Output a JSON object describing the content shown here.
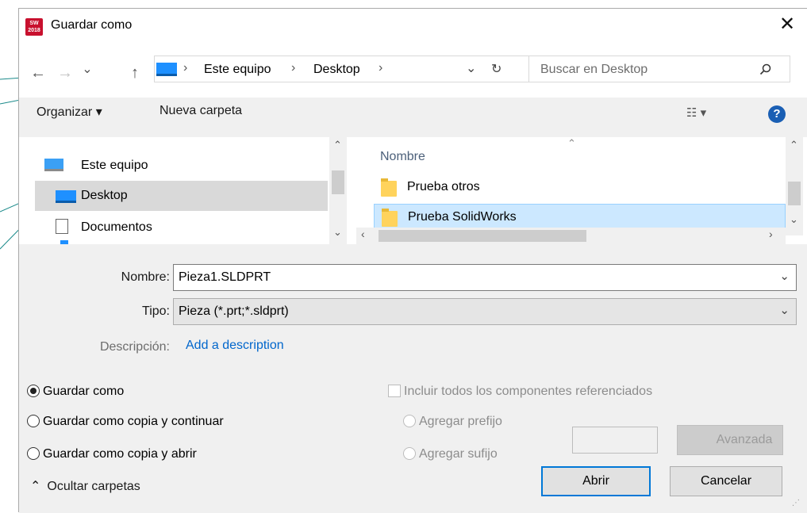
{
  "window": {
    "title": "Guardar como",
    "app_icon_text": "SW 2018"
  },
  "nav": {
    "back_arrow": "←",
    "forward_arrow": "→",
    "recent_chevron": "⌄",
    "up_arrow": "↑",
    "breadcrumb": [
      "Este equipo",
      "Desktop"
    ],
    "separator": "›",
    "refresh": "↻",
    "search_placeholder": "Buscar en Desktop"
  },
  "toolbar": {
    "organize": "Organizar ▾",
    "new_folder": "Nueva carpeta",
    "view_icon": "view-options-icon",
    "help": "?"
  },
  "nav_pane": {
    "items": [
      {
        "label": "Este equipo",
        "icon": "computer-icon"
      },
      {
        "label": "Desktop",
        "icon": "desktop-icon",
        "selected": true
      },
      {
        "label": "Documentos",
        "icon": "documents-icon"
      }
    ]
  },
  "file_pane": {
    "column_header": "Nombre",
    "rows": [
      {
        "label": "Prueba otros",
        "icon": "folder-icon"
      },
      {
        "label": "Prueba SolidWorks",
        "icon": "folder-icon",
        "selected": true
      }
    ]
  },
  "form": {
    "name_label": "Nombre:",
    "name_value": "Pieza1.SLDPRT",
    "type_label": "Tipo:",
    "type_value": "Pieza (*.prt;*.sldprt)",
    "desc_label": "Descripción:",
    "desc_link": "Add a description"
  },
  "options": {
    "radio_save": "Guardar como",
    "radio_copy_continue": "Guardar como copia y continuar",
    "radio_copy_open": "Guardar como copia y abrir",
    "include_refs": "Incluir todos los componentes referenciados",
    "add_prefix": "Agregar prefijo",
    "add_suffix": "Agregar sufijo",
    "advanced": "Avanzada"
  },
  "footer": {
    "hide_folders": "Ocultar carpetas",
    "open": "Abrir",
    "cancel": "Cancelar"
  },
  "colors": {
    "accent": "#0078d7",
    "link": "#0066cc",
    "selection": "#cce8ff",
    "callout": "#1a8a8a"
  }
}
